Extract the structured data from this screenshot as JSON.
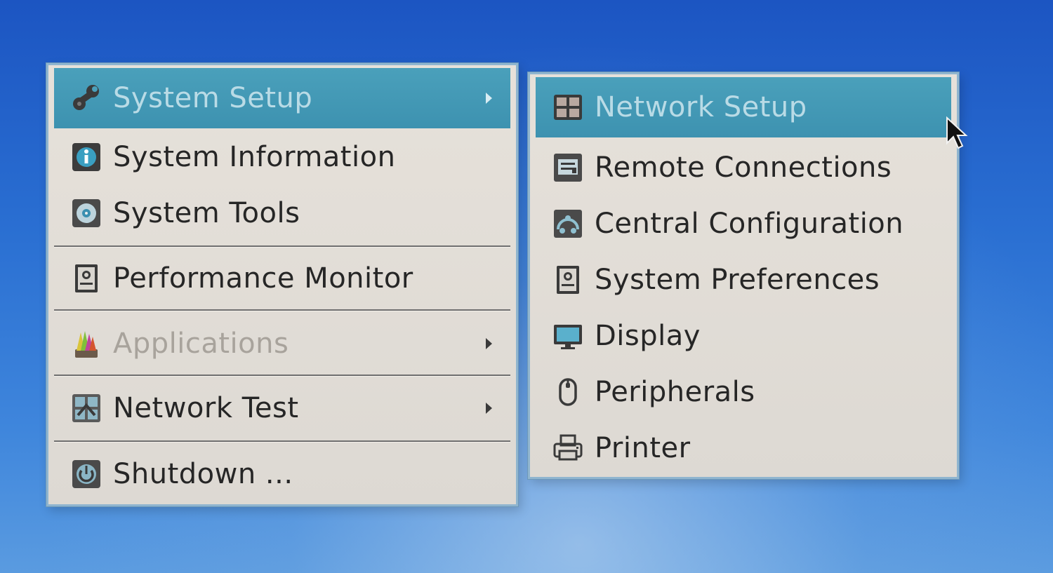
{
  "main_menu": {
    "items": [
      {
        "label": "System Setup",
        "icon": "wrench-icon",
        "submenu": true,
        "highlighted": true
      },
      {
        "label": "System Information",
        "icon": "info-icon"
      },
      {
        "label": "System Tools",
        "icon": "tools-disc-icon"
      },
      {
        "label": "Performance Monitor",
        "icon": "monitor-device-icon"
      },
      {
        "label": "Applications",
        "icon": "applications-icon",
        "submenu": true,
        "disabled": true
      },
      {
        "label": "Network Test",
        "icon": "network-test-icon",
        "submenu": true
      },
      {
        "label": "Shutdown ...",
        "icon": "power-icon"
      }
    ]
  },
  "sub_menu": {
    "items": [
      {
        "label": "Network Setup",
        "icon": "network-setup-icon",
        "highlighted": true
      },
      {
        "label": "Remote Connections",
        "icon": "remote-connections-icon"
      },
      {
        "label": "Central Configuration",
        "icon": "central-configuration-icon"
      },
      {
        "label": "System Preferences",
        "icon": "system-preferences-icon"
      },
      {
        "label": "Display",
        "icon": "display-icon"
      },
      {
        "label": "Peripherals",
        "icon": "mouse-icon"
      },
      {
        "label": "Printer",
        "icon": "printer-icon"
      }
    ]
  },
  "colors": {
    "highlight": "#3d92b0",
    "menu_bg": "#e2ded8",
    "desktop": "#2a6fd2"
  }
}
